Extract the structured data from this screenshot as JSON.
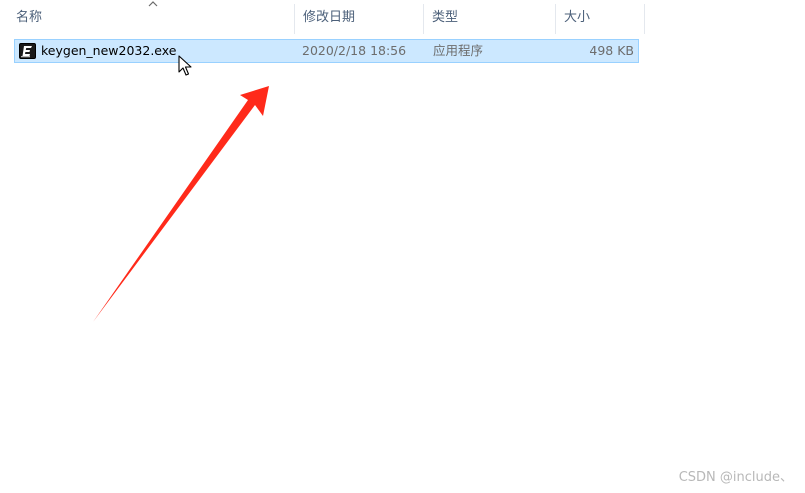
{
  "columns": {
    "name": "名称",
    "date": "修改日期",
    "type": "类型",
    "size": "大小"
  },
  "files": [
    {
      "name": "keygen_new2032.exe",
      "date": "2020/2/18 18:56",
      "type": "应用程序",
      "size": "498 KB",
      "icon": "executable-icon",
      "selected": true
    }
  ],
  "sort": {
    "column": "name",
    "indicator": "chevron-up-icon"
  },
  "annotation": {
    "shape": "red-arrow",
    "color": "#ff2a1a"
  },
  "colors": {
    "selection_bg": "#cce8ff",
    "selection_border": "#99d1ff",
    "header_text": "#4c607a",
    "secondary_text": "#6d6d6d"
  },
  "watermark": "CSDN @include、"
}
